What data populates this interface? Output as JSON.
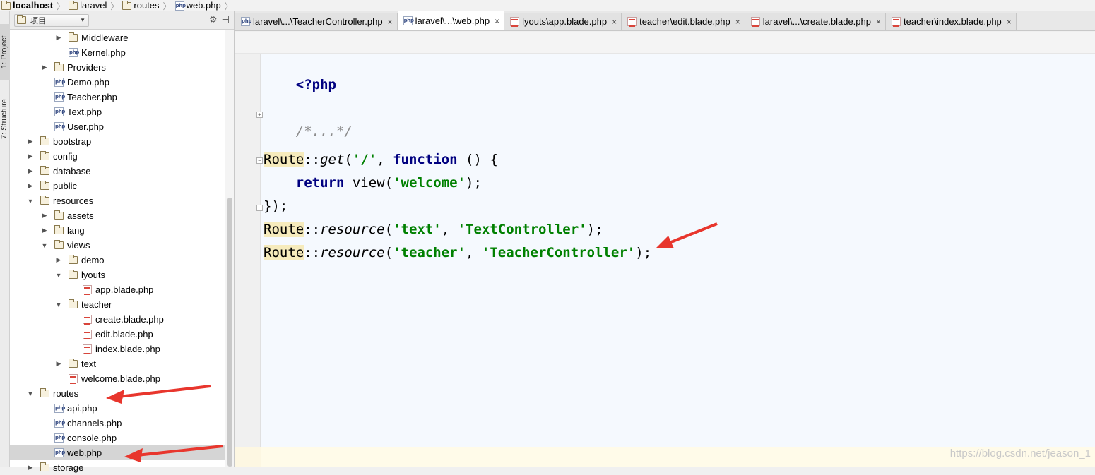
{
  "breadcrumb": [
    "localhost",
    "laravel",
    "routes",
    "web.php"
  ],
  "tool_windows": {
    "project": "1: Project",
    "structure": "7: Structure"
  },
  "project_panel": {
    "view_mode": "项目",
    "tools": [
      "⚙",
      "⊣"
    ]
  },
  "tree": [
    {
      "label": "Middleware",
      "kind": "folder",
      "depth": 4,
      "state": "collapsed"
    },
    {
      "label": "Kernel.php",
      "kind": "php",
      "depth": 4,
      "state": "leaf"
    },
    {
      "label": "Providers",
      "kind": "folder",
      "depth": 3,
      "state": "collapsed"
    },
    {
      "label": "Demo.php",
      "kind": "php",
      "depth": 3,
      "state": "leaf"
    },
    {
      "label": "Teacher.php",
      "kind": "php",
      "depth": 3,
      "state": "leaf"
    },
    {
      "label": "Text.php",
      "kind": "php",
      "depth": 3,
      "state": "leaf"
    },
    {
      "label": "User.php",
      "kind": "php",
      "depth": 3,
      "state": "leaf"
    },
    {
      "label": "bootstrap",
      "kind": "folder",
      "depth": 2,
      "state": "collapsed"
    },
    {
      "label": "config",
      "kind": "folder",
      "depth": 2,
      "state": "collapsed"
    },
    {
      "label": "database",
      "kind": "folder",
      "depth": 2,
      "state": "collapsed"
    },
    {
      "label": "public",
      "kind": "folder",
      "depth": 2,
      "state": "collapsed"
    },
    {
      "label": "resources",
      "kind": "folder",
      "depth": 2,
      "state": "expanded"
    },
    {
      "label": "assets",
      "kind": "folder",
      "depth": 3,
      "state": "collapsed"
    },
    {
      "label": "lang",
      "kind": "folder",
      "depth": 3,
      "state": "collapsed"
    },
    {
      "label": "views",
      "kind": "folder",
      "depth": 3,
      "state": "expanded"
    },
    {
      "label": "demo",
      "kind": "folder",
      "depth": 4,
      "state": "collapsed"
    },
    {
      "label": "lyouts",
      "kind": "folder",
      "depth": 4,
      "state": "expanded"
    },
    {
      "label": "app.blade.php",
      "kind": "blade",
      "depth": 5,
      "state": "leaf"
    },
    {
      "label": "teacher",
      "kind": "folder",
      "depth": 4,
      "state": "expanded"
    },
    {
      "label": "create.blade.php",
      "kind": "blade",
      "depth": 5,
      "state": "leaf"
    },
    {
      "label": "edit.blade.php",
      "kind": "blade",
      "depth": 5,
      "state": "leaf"
    },
    {
      "label": "index.blade.php",
      "kind": "blade",
      "depth": 5,
      "state": "leaf"
    },
    {
      "label": "text",
      "kind": "folder",
      "depth": 4,
      "state": "collapsed"
    },
    {
      "label": "welcome.blade.php",
      "kind": "blade",
      "depth": 4,
      "state": "leaf"
    },
    {
      "label": "routes",
      "kind": "folder",
      "depth": 2,
      "state": "expanded"
    },
    {
      "label": "api.php",
      "kind": "php",
      "depth": 3,
      "state": "leaf"
    },
    {
      "label": "channels.php",
      "kind": "php",
      "depth": 3,
      "state": "leaf"
    },
    {
      "label": "console.php",
      "kind": "php",
      "depth": 3,
      "state": "leaf"
    },
    {
      "label": "web.php",
      "kind": "php",
      "depth": 3,
      "state": "leaf",
      "selected": true
    },
    {
      "label": "storage",
      "kind": "folder",
      "depth": 2,
      "state": "collapsed"
    }
  ],
  "tabs": [
    {
      "label": "laravel\\...\\TeacherController.php",
      "icon": "php",
      "active": false
    },
    {
      "label": "laravel\\...\\web.php",
      "icon": "php",
      "active": true
    },
    {
      "label": "lyouts\\app.blade.php",
      "icon": "blade",
      "active": false
    },
    {
      "label": "teacher\\edit.blade.php",
      "icon": "blade",
      "active": false
    },
    {
      "label": "laravel\\...\\create.blade.php",
      "icon": "blade",
      "active": false
    },
    {
      "label": "teacher\\index.blade.php",
      "icon": "blade",
      "active": false
    }
  ],
  "code": {
    "open_tag": "<?php",
    "folded_comment": "/*...*/",
    "route_get": {
      "class": "Route",
      "method": "get",
      "path": "'/'",
      "keyword": "function"
    },
    "return_line": {
      "keyword": "return",
      "call": "view",
      "arg": "'welcome'"
    },
    "closing": "});",
    "resource_1": {
      "class": "Route",
      "method": "resource",
      "name": "'text'",
      "controller": "'TextController'"
    },
    "resource_2": {
      "class": "Route",
      "method": "resource",
      "name": "'teacher'",
      "controller": "'TeacherController'"
    }
  },
  "watermark": "https://blog.csdn.net/jeason_1",
  "annotation_color": "#e8362d"
}
